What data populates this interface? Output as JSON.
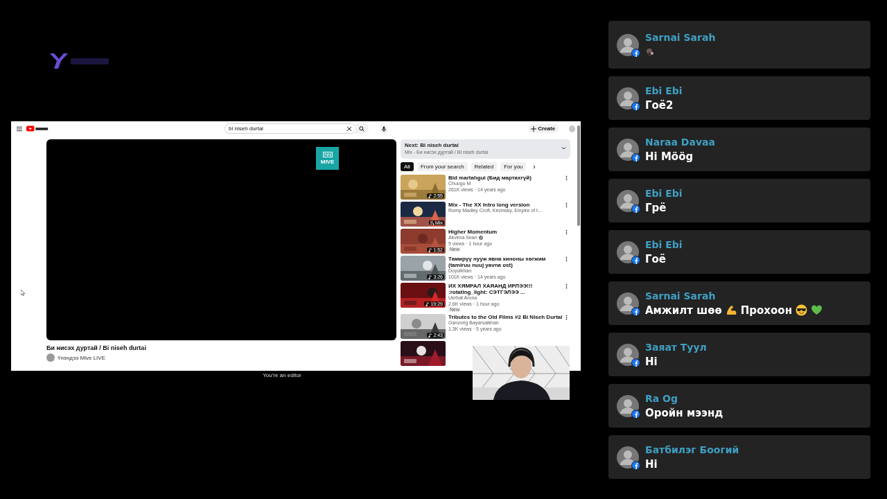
{
  "screen_share": {
    "youtube": {
      "search": {
        "value": "bi niseh durtai"
      },
      "create_button": "Create",
      "player": {
        "logo_text": "MIVE"
      },
      "video_title": "Би нисэх дуртай / Bi niseh durtai",
      "channel": "Үнэндээ Mive LIVE",
      "queue": {
        "title": "Next: Bi niseh durtai",
        "subtitle": "Mix - Би нисэх дуртай / Bi niseh durtai"
      },
      "chips": [
        {
          "label": "All",
          "selected": true
        },
        {
          "label": "From your search",
          "selected": false
        },
        {
          "label": "Related",
          "selected": false
        },
        {
          "label": "For you",
          "selected": false
        }
      ],
      "videos": [
        {
          "kind": "video",
          "title": "Bid martahgui (Бид мартахгүй)",
          "channel": "Chuugo M",
          "meta": "261K views · 14 years ago",
          "duration": "2:55"
        },
        {
          "kind": "mix",
          "title": "Mix - The XX   Intro long version",
          "channel": "Romy Madley Croft, Kevinsky, Empire of t...",
          "duration": "Mix"
        },
        {
          "kind": "video",
          "title": "Higher Momentum",
          "channel": "Akvena Sean",
          "verified": true,
          "meta": "5 views · 1 hour ago",
          "badge": "New",
          "duration": "1:52"
        },
        {
          "kind": "video",
          "title": "Тамирүү нууж явна киноны хөгжим (tamiruu nuuj yavna ost)",
          "channel": "Doyolkhan",
          "meta": "101K views · 14 years ago",
          "duration": "3:26"
        },
        {
          "kind": "video",
          "title": "ИХ ХЯМРАЛ ХАЯАНД ИРЛЭЭ!!! :rotating_light: СЭТГЭЛЭЭ ...",
          "channel": "Uerbat Aruna",
          "meta": "2.6K views · 1 hour ago",
          "badge": "New",
          "duration": "19:29"
        },
        {
          "kind": "video",
          "title": "Tributes to the Old Films #2   Bi Niseh Durtai",
          "channel": "Ganzorig Bayarsaikhan",
          "meta": "1.3K views · 5 years ago",
          "duration": "2:43"
        },
        {
          "kind": "cut"
        }
      ]
    },
    "editor_notice": "You're an editor"
  },
  "chat": [
    {
      "name": "Sarnai Sarah",
      "message": [
        {
          "kind": "sticker"
        }
      ]
    },
    {
      "name": "Ebi Ebi",
      "message": [
        {
          "kind": "text",
          "text": "Гоё2"
        }
      ]
    },
    {
      "name": "Naraa Davaa",
      "message": [
        {
          "kind": "text",
          "text": "Hi Möög"
        }
      ]
    },
    {
      "name": "Ebi Ebi",
      "message": [
        {
          "kind": "text",
          "text": "Грё"
        }
      ]
    },
    {
      "name": "Ebi Ebi",
      "message": [
        {
          "kind": "text",
          "text": "Гоё"
        }
      ]
    },
    {
      "name": "Sarnai Sarah",
      "message": [
        {
          "kind": "text",
          "text": "Амжилт шөө"
        },
        {
          "kind": "muscle"
        },
        {
          "kind": "text",
          "text": "Прохоон"
        },
        {
          "kind": "sunglasses"
        },
        {
          "kind": "heart"
        }
      ]
    },
    {
      "name": "Заяат Туул",
      "message": [
        {
          "kind": "text",
          "text": "Hi"
        }
      ]
    },
    {
      "name": "Ra Og",
      "message": [
        {
          "kind": "text",
          "text": "Оройн мээнд"
        }
      ]
    },
    {
      "name": "Батбилэг Боогий",
      "message": [
        {
          "kind": "text",
          "text": "Hi"
        }
      ]
    }
  ]
}
